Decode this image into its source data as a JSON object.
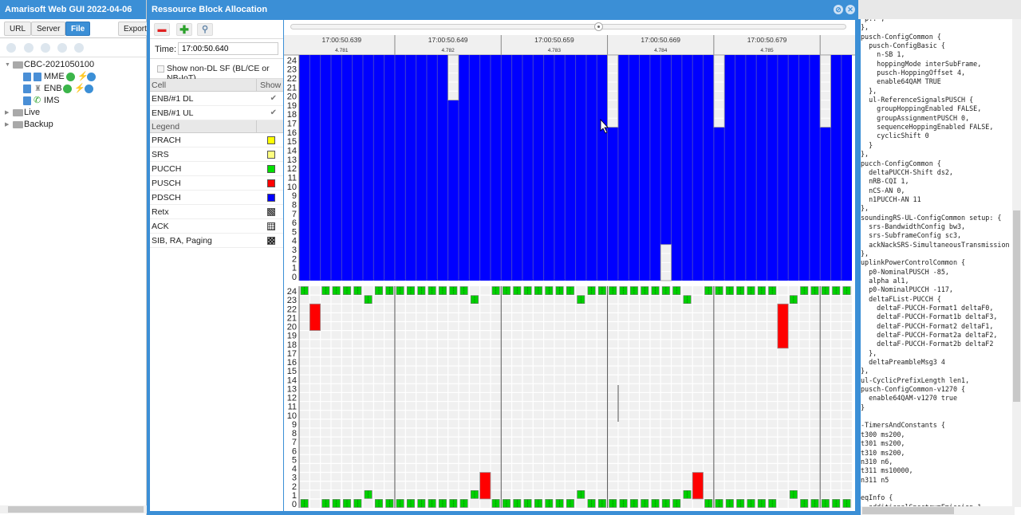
{
  "app": {
    "title": "Amarisoft Web GUI 2022-04-06",
    "toolbar": {
      "url": "URL",
      "server": "Server",
      "file": "File",
      "export": "Export"
    },
    "tree": [
      {
        "label": "CBC-2021050100",
        "type": "folder",
        "expanded": true
      },
      {
        "label": "MME",
        "type": "node"
      },
      {
        "label": "ENB",
        "type": "node"
      },
      {
        "label": "IMS",
        "type": "node"
      },
      {
        "label": "Live",
        "type": "folder",
        "expanded": false
      },
      {
        "label": "Backup",
        "type": "folder",
        "expanded": false
      }
    ]
  },
  "dialog": {
    "title": "Ressource Block Allocation",
    "time_label": "Time:",
    "time_value": "17:00:50.640",
    "show_non_dl_label": "Show non-DL SF (BL/CE or NB-IoT)",
    "show_non_dl_checked": false,
    "cell_header": "Cell",
    "show_header": "Show",
    "cells": [
      {
        "name": "ENB/#1 DL",
        "show": true
      },
      {
        "name": "ENB/#1 UL",
        "show": true
      }
    ],
    "legend_header": "Legend",
    "legend": [
      {
        "name": "PRACH",
        "color": "#ffff00",
        "pattern": "solid"
      },
      {
        "name": "SRS",
        "color": "#ffff80",
        "pattern": "solid"
      },
      {
        "name": "PUCCH",
        "color": "#00e000",
        "pattern": "solid"
      },
      {
        "name": "PUSCH",
        "color": "#ff0000",
        "pattern": "solid"
      },
      {
        "name": "PDSCH",
        "color": "#0000ff",
        "pattern": "solid"
      },
      {
        "name": "Retx",
        "color": "#555555",
        "pattern": "hatch"
      },
      {
        "name": "ACK",
        "color": "#888888",
        "pattern": "dots"
      },
      {
        "name": "SIB, RA, Paging",
        "color": "#333333",
        "pattern": "checker"
      }
    ]
  },
  "chart_data": {
    "type": "heatmap",
    "frames": [
      {
        "time": "17:00:50.639",
        "sfn": "4.781"
      },
      {
        "time": "17:00:50.649",
        "sfn": "4.782"
      },
      {
        "time": "17:00:50.659",
        "sfn": "4.783"
      },
      {
        "time": "17:00:50.669",
        "sfn": "4.784"
      },
      {
        "time": "17:00:50.679",
        "sfn": "4.785"
      }
    ],
    "subframes_per_frame": 10,
    "visible_columns": 53,
    "first_column_subframe_offset": 1,
    "rb_rows": 25,
    "y_ticks": [
      0,
      1,
      2,
      3,
      4,
      5,
      6,
      7,
      8,
      9,
      10,
      11,
      12,
      13,
      14,
      15,
      16,
      17,
      18,
      19,
      20,
      21,
      22,
      23,
      24
    ],
    "dl": {
      "label": "ENB/#1 DL",
      "default_fill": "PDSCH",
      "empty_ranges": [
        {
          "col": 14,
          "rb_from": 20,
          "rb_to": 24
        },
        {
          "col": 29,
          "rb_from": 17,
          "rb_to": 24
        },
        {
          "col": 34,
          "rb_from": 0,
          "rb_to": 3
        },
        {
          "col": 39,
          "rb_from": 17,
          "rb_to": 24
        },
        {
          "col": 49,
          "rb_from": 17,
          "rb_to": 24
        }
      ]
    },
    "ul": {
      "label": "ENB/#1 UL",
      "pucch": [
        {
          "rb": 24,
          "cols": [
            0,
            2,
            3,
            4,
            5,
            7,
            8,
            9,
            10,
            11,
            12,
            13,
            14,
            15,
            18,
            19,
            20,
            21,
            22,
            23,
            24,
            25,
            27,
            28,
            29,
            30,
            31,
            32,
            33,
            34,
            35,
            38,
            39,
            40,
            41,
            42,
            43,
            44,
            47,
            48,
            49,
            50,
            51,
            52
          ]
        },
        {
          "rb": 23,
          "cols": [
            6,
            16,
            26,
            36,
            46
          ]
        },
        {
          "rb": 1,
          "cols": [
            6,
            16,
            26,
            36,
            46
          ]
        },
        {
          "rb": 0,
          "cols": [
            0,
            2,
            3,
            4,
            5,
            7,
            8,
            9,
            10,
            11,
            12,
            13,
            14,
            15,
            18,
            19,
            20,
            21,
            22,
            23,
            24,
            25,
            27,
            28,
            29,
            30,
            31,
            32,
            33,
            34,
            35,
            38,
            39,
            40,
            41,
            42,
            43,
            44,
            47,
            48,
            49,
            50,
            51
          ]
        }
      ],
      "pusch": [
        {
          "col": 1,
          "rb_from": 20,
          "rb_to": 22
        },
        {
          "col": 45,
          "rb_from": 18,
          "rb_to": 22
        },
        {
          "col": 17,
          "rb_from": 1,
          "rb_to": 3
        },
        {
          "col": 37,
          "rb_from": 1,
          "rb_to": 3
        }
      ]
    }
  },
  "config_text": " p.. ,\n},\npusch-ConfigCommon {\n  pusch-ConfigBasic {\n    n-SB 1,\n    hoppingMode interSubFrame,\n    pusch-HoppingOffset 4,\n    enable64QAM TRUE\n  },\n  ul-ReferenceSignalsPUSCH {\n    groupHoppingEnabled FALSE,\n    groupAssignmentPUSCH 0,\n    sequenceHoppingEnabled FALSE,\n    cyclicShift 0\n  }\n},\npucch-ConfigCommon {\n  deltaPUCCH-Shift ds2,\n  nRB-CQI 1,\n  nCS-AN 0,\n  n1PUCCH-AN 11\n},\nsoundingRS-UL-ConfigCommon setup: {\n  srs-BandwidthConfig bw3,\n  srs-SubframeConfig sc3,\n  ackNackSRS-SimultaneousTransmission TRUE\n},\nuplinkPowerControlCommon {\n  p0-NominalPUSCH -85,\n  alpha al1,\n  p0-NominalPUCCH -117,\n  deltaFList-PUCCH {\n    deltaF-PUCCH-Format1 deltaF0,\n    deltaF-PUCCH-Format1b deltaF3,\n    deltaF-PUCCH-Format2 deltaF1,\n    deltaF-PUCCH-Format2a deltaF2,\n    deltaF-PUCCH-Format2b deltaF2\n  },\n  deltaPreambleMsg3 4\n},\nul-CyclicPrefixLength len1,\npusch-ConfigCommon-v1270 {\n  enable64QAM-v1270 true\n}\n\n-TimersAndConstants {\nt300 ms200,\nt301 ms200,\nt310 ms200,\nn310 n6,\nt311 ms10000,\nn311 n5\n\neqInfo {\n  additionalSpectrumEmission 1"
}
